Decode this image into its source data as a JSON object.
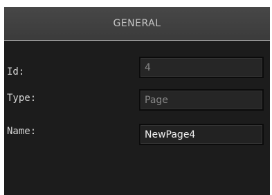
{
  "panel": {
    "title": "GENERAL",
    "fields": [
      {
        "label": "Id:",
        "value": "4"
      },
      {
        "label": "Type:",
        "value": "Page"
      },
      {
        "label": "Name:",
        "value": "NewPage4"
      }
    ]
  }
}
